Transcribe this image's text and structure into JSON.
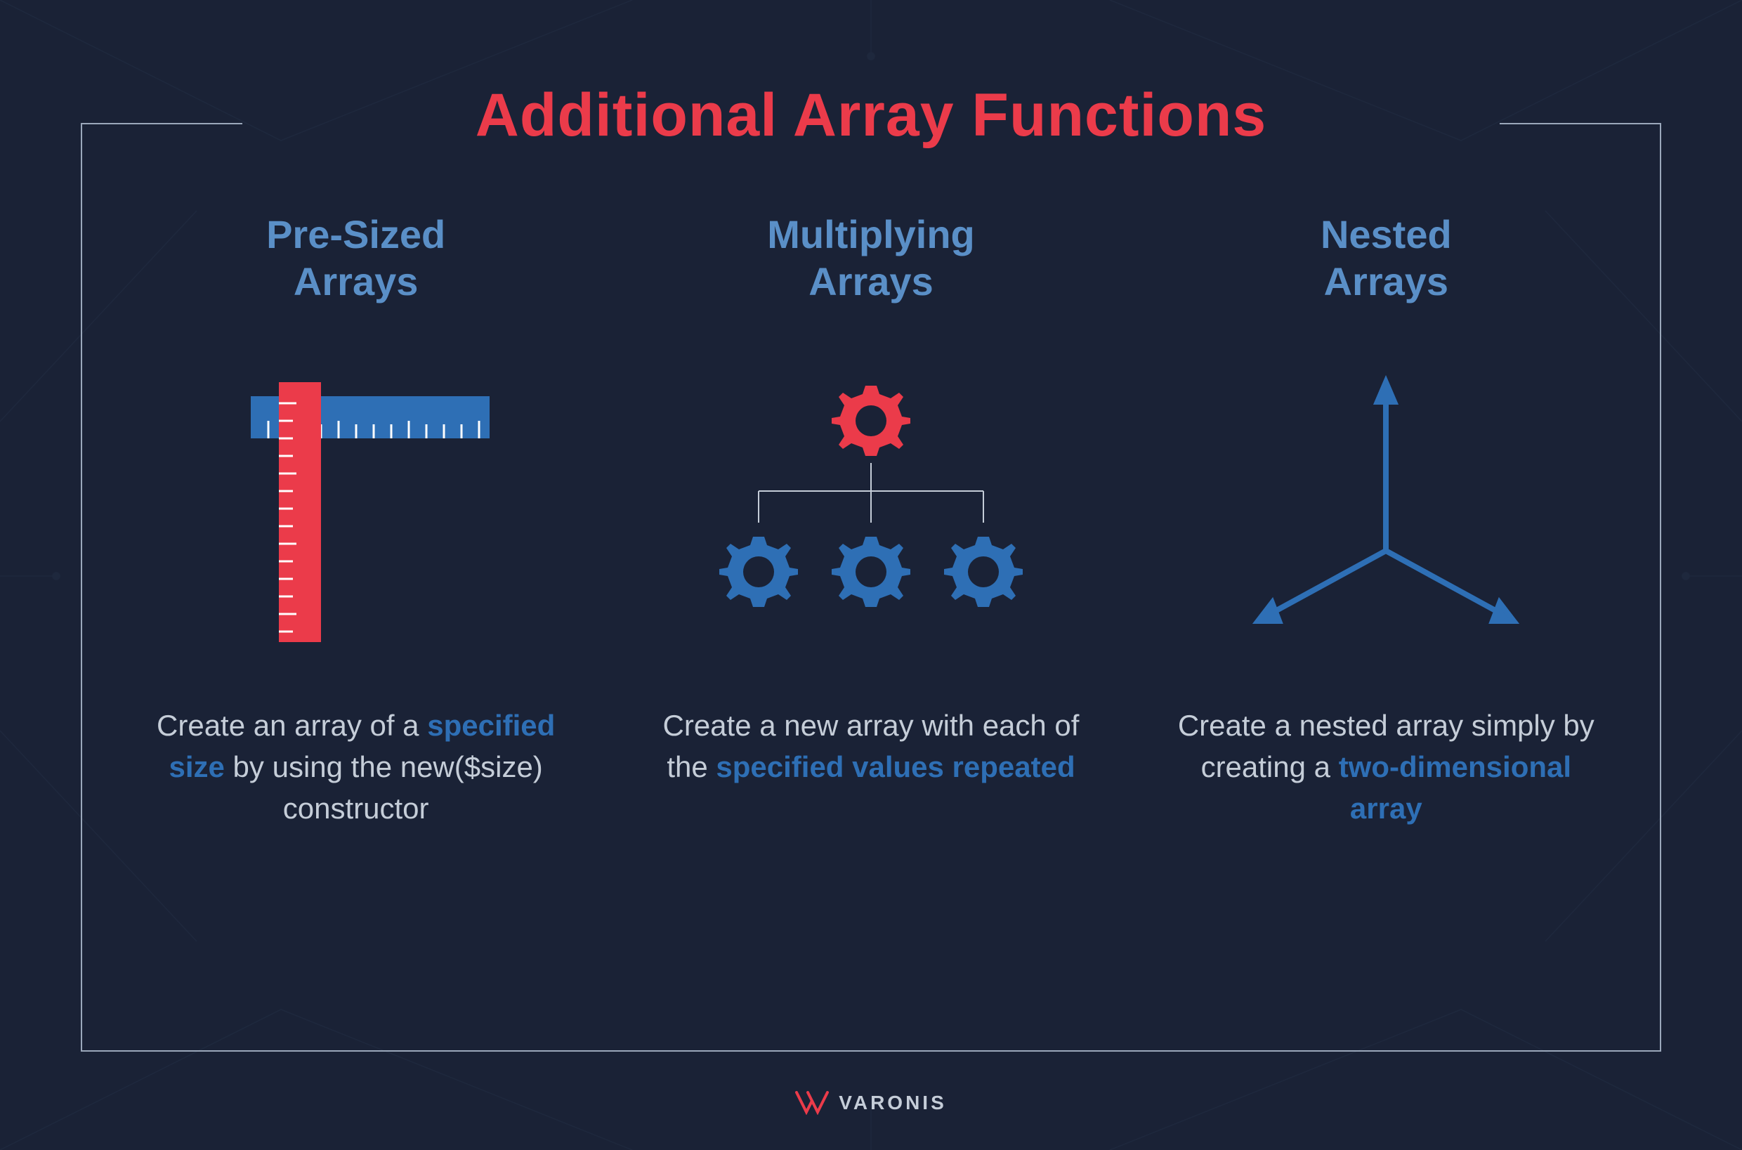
{
  "title": "Additional Array Functions",
  "columns": [
    {
      "heading_line1": "Pre-Sized",
      "heading_line2": "Arrays",
      "desc_pre": "Create an array of a ",
      "desc_highlight": "specified size",
      "desc_post": " by using the new($size) constructor"
    },
    {
      "heading_line1": "Multiplying",
      "heading_line2": "Arrays",
      "desc_pre": "Create a new array with each of the ",
      "desc_highlight": "specified values repeated",
      "desc_post": ""
    },
    {
      "heading_line1": "Nested",
      "heading_line2": "Arrays",
      "desc_pre": "Create a nested array simply by creating a ",
      "desc_highlight": "two-dimensional array",
      "desc_post": ""
    }
  ],
  "logo": {
    "text": "VARONIS"
  },
  "colors": {
    "background": "#1a2236",
    "accent_red": "#eb3b4a",
    "accent_blue": "#2e6fb5",
    "text_light": "#c5cdd8",
    "subtitle_blue": "#5a8fc7"
  }
}
